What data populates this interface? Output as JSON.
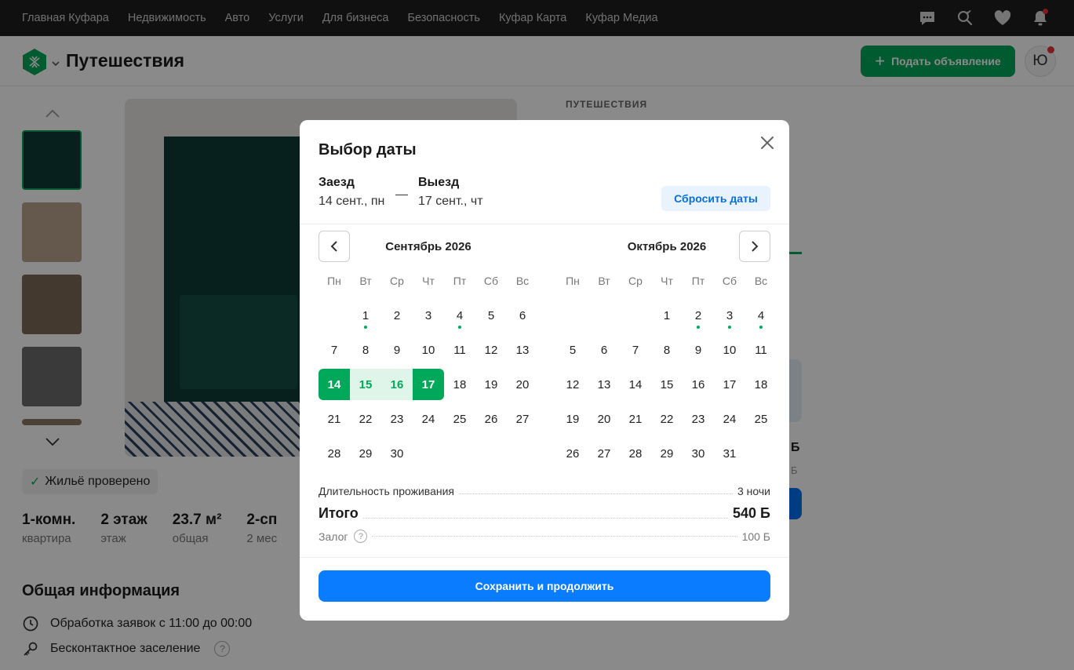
{
  "topnav": {
    "links": [
      "Главная Куфара",
      "Недвижимость",
      "Авто",
      "Услуги",
      "Для бизнеса",
      "Безопасность",
      "Куфар Карта",
      "Куфар Медиа"
    ]
  },
  "header": {
    "title": "Путешествия",
    "post_button": "Подать объявление",
    "avatar_letter": "Ю",
    "brand_color": "#00a85a"
  },
  "background": {
    "verified": "Жильё проверено",
    "specs": [
      {
        "value": "1-комн.",
        "label": "квартира"
      },
      {
        "value": "2 этаж",
        "label": "этаж"
      },
      {
        "value": "23.7 м²",
        "label": "общая"
      },
      {
        "value": "2-сп",
        "label": "2 мес"
      }
    ],
    "section_title": "Общая информация",
    "info": [
      "Обработка заявок с 11:00 до 00:00",
      "Бесконтактное заселение"
    ],
    "category": "ПУТЕШЕСТВИЯ",
    "right_price": "Б",
    "right_price_sub": "Б"
  },
  "modal": {
    "title": "Выбор даты",
    "checkin_label": "Заезд",
    "checkin_value": "14 сент., пн",
    "checkout_label": "Выезд",
    "checkout_value": "17 сент., чт",
    "reset_button": "Сбросить даты",
    "weekdays": [
      "Пн",
      "Вт",
      "Ср",
      "Чт",
      "Пт",
      "Сб",
      "Вс"
    ],
    "months": [
      {
        "title": "Сентябрь 2026",
        "weeks": [
          [
            "",
            "1",
            "2",
            "3",
            "4",
            "5",
            "6"
          ],
          [
            "7",
            "8",
            "9",
            "10",
            "11",
            "12",
            "13"
          ],
          [
            "14",
            "15",
            "16",
            "17",
            "18",
            "19",
            "20"
          ],
          [
            "21",
            "22",
            "23",
            "24",
            "25",
            "26",
            "27"
          ],
          [
            "28",
            "29",
            "30",
            "",
            "",
            "",
            ""
          ]
        ],
        "marked_days": [
          "1",
          "4"
        ],
        "range_start": "14",
        "range_days": [
          "15",
          "16"
        ],
        "range_end": "17"
      },
      {
        "title": "Октябрь 2026",
        "weeks": [
          [
            "",
            "",
            "",
            "1",
            "2",
            "3",
            "4"
          ],
          [
            "5",
            "6",
            "7",
            "8",
            "9",
            "10",
            "11"
          ],
          [
            "12",
            "13",
            "14",
            "15",
            "16",
            "17",
            "18"
          ],
          [
            "19",
            "20",
            "21",
            "22",
            "23",
            "24",
            "25"
          ],
          [
            "26",
            "27",
            "28",
            "29",
            "30",
            "31",
            ""
          ]
        ],
        "marked_days": [
          "2",
          "3",
          "4"
        ]
      }
    ],
    "duration_label": "Длительность проживания",
    "duration_value": "3 ночи",
    "total_label": "Итого",
    "total_value": "540 Б",
    "deposit_label": "Залог",
    "deposit_value": "100 Б",
    "save_button": "Сохранить и продолжить"
  }
}
